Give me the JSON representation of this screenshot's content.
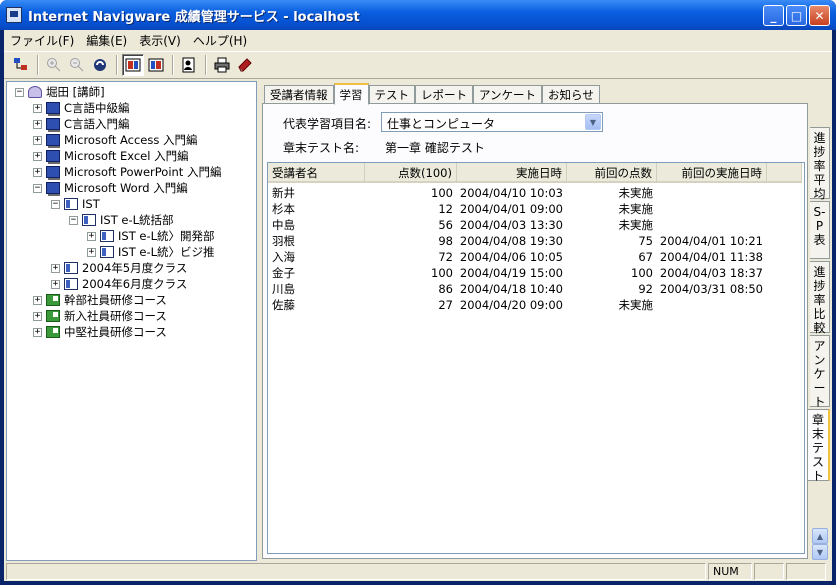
{
  "window": {
    "title": "Internet Navigware 成績管理サービス - localhost",
    "minimize": "_",
    "maximize": "□",
    "close": "✕"
  },
  "menu": [
    "ファイル(F)",
    "編集(E)",
    "表示(V)",
    "ヘルプ(H)"
  ],
  "toolbar_icons": [
    "tree-icon",
    "zoom-in-icon",
    "zoom-out-icon",
    "refresh-icon",
    "view-left-icon",
    "view-right-icon",
    "find-user-icon",
    "print-icon",
    "book-icon"
  ],
  "tree": {
    "root": "堀田 [講師]",
    "courses": [
      "C言語中級編",
      "C言語入門編",
      "Microsoft Access 入門編",
      "Microsoft Excel 入門編",
      "Microsoft PowerPoint 入門編",
      "Microsoft Word 入門編"
    ],
    "ist": "IST",
    "ist_group": "IST e-L統括部",
    "ist_sub1": "IST e-L統〉開発部",
    "ist_sub2": "IST e-L統〉ビジ推",
    "class1": "2004年5月度クラス",
    "class2": "2004年6月度クラス",
    "groups": [
      "幹部社員研修コース",
      "新入社員研修コース",
      "中堅社員研修コース"
    ]
  },
  "tabs": [
    "受講者情報",
    "学習",
    "テスト",
    "レポート",
    "アンケート",
    "お知らせ"
  ],
  "side_tabs": [
    "進捗率平均",
    "S-P表",
    "進捗率比較",
    "アンケート",
    "章末テスト"
  ],
  "form": {
    "item_label": "代表学習項目名:",
    "item_value": "仕事とコンピュータ",
    "test_label": "章末テスト名:",
    "test_value": "第一章 確認テスト"
  },
  "table": {
    "headers": [
      "受講者名",
      "点数(100)",
      "実施日時",
      "前回の点数",
      "前回の実施日時"
    ],
    "rows": [
      [
        "新井",
        "100",
        "2004/04/10 10:03",
        "未実施",
        ""
      ],
      [
        "杉本",
        "12",
        "2004/04/01 09:00",
        "未実施",
        ""
      ],
      [
        "中島",
        "56",
        "2004/04/03 13:30",
        "未実施",
        ""
      ],
      [
        "羽根",
        "98",
        "2004/04/08 19:30",
        "75",
        "2004/04/01 10:21"
      ],
      [
        "入海",
        "72",
        "2004/04/06 10:05",
        "67",
        "2004/04/01 11:38"
      ],
      [
        "金子",
        "100",
        "2004/04/19 15:00",
        "100",
        "2004/04/03 18:37"
      ],
      [
        "川島",
        "86",
        "2004/04/18 10:40",
        "92",
        "2004/03/31 08:50"
      ],
      [
        "佐藤",
        "27",
        "2004/04/20 09:00",
        "未実施",
        ""
      ]
    ]
  },
  "status": {
    "num": "NUM"
  }
}
